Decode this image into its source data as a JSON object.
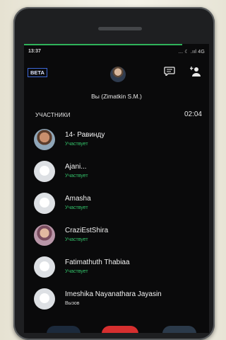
{
  "status_bar": {
    "time": "13:37",
    "indicators": "... ☾ .ııl 4G"
  },
  "header": {
    "beta_label": "BETA",
    "chat_icon": "chat-bubble-icon",
    "add_user_icon": "add-user-icon",
    "host_name": "Вы (Zimatkin S.M.)"
  },
  "participants_section": {
    "title": "УЧАСТНИКИ",
    "timer": "02:04",
    "items": [
      {
        "name": "14- Равинду",
        "status": "Участвует",
        "avatar": "photo"
      },
      {
        "name": "Ajani...",
        "status": "Участвует",
        "avatar": "placeholder"
      },
      {
        "name": "Amasha",
        "status": "Участвует",
        "avatar": "placeholder"
      },
      {
        "name": "CraziEstShira",
        "status": "Участвует",
        "avatar": "photo"
      },
      {
        "name": "Fatimathuth Thabiaa",
        "status": "Участвует",
        "avatar": "placeholder"
      },
      {
        "name": "Imeshika Nayanathara Jayasin",
        "status": "Вызов",
        "avatar": "placeholder"
      }
    ]
  },
  "colors": {
    "accent_green": "#2fb35a",
    "beta_border": "#3c67d6",
    "end_call_red": "#d62f2f"
  }
}
